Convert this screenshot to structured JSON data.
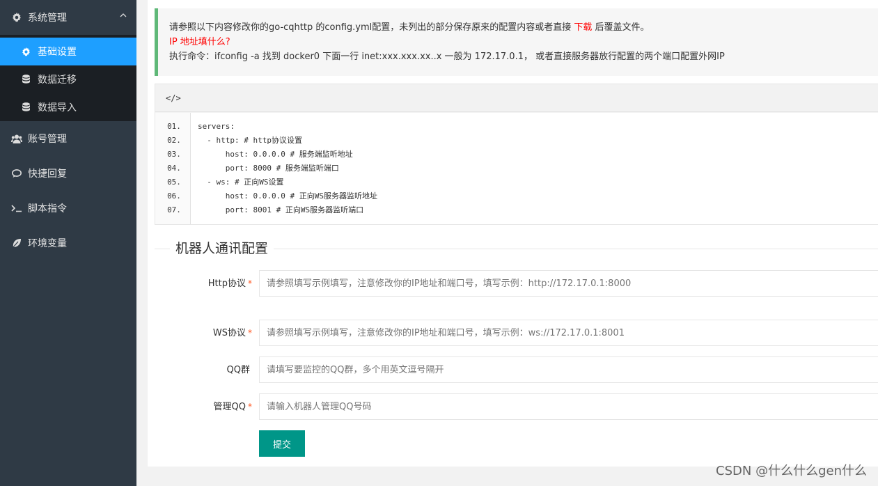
{
  "sidebar": {
    "items": [
      {
        "label": "系统管理",
        "icon": "gear-icon"
      },
      {
        "label": "账号管理",
        "icon": "users-icon"
      },
      {
        "label": "快捷回复",
        "icon": "chat-icon"
      },
      {
        "label": "脚本指令",
        "icon": "terminal-icon"
      },
      {
        "label": "环境变量",
        "icon": "leaf-icon"
      }
    ],
    "submenu": [
      {
        "label": "基础设置",
        "icon": "gear-icon",
        "active": true
      },
      {
        "label": "数据迁移",
        "icon": "database-icon"
      },
      {
        "label": "数据导入",
        "icon": "database-icon"
      }
    ]
  },
  "notice": {
    "line1_prefix": "请参照以下内容修改你的go-cqhttp 的config.yml配置，未列出的部分保存原来的配置内容或者直接 ",
    "line1_link": "下载",
    "line1_suffix": " 后覆盖文件。",
    "line2": "IP 地址填什么?",
    "line3": "执行命令：ifconfig -a 找到 docker0 下面一行 inet:xxx.xxx.xx..x 一般为 172.17.0.1， 或者直接服务器放行配置的两个端口配置外网IP"
  },
  "code": {
    "header": "</>",
    "line_numbers": [
      "01.",
      "02.",
      "03.",
      "04.",
      "05.",
      "06.",
      "07."
    ],
    "lines": [
      "servers:",
      "  - http: # http协议设置",
      "      host: 0.0.0.0 # 服务端监听地址",
      "      port: 8000 # 服务端监听端口",
      "  - ws: # 正向WS设置",
      "      host: 0.0.0.0 # 正向WS服务器监听地址",
      "      port: 8001 # 正向WS服务器监听端口"
    ]
  },
  "form": {
    "legend": "机器人通讯配置",
    "fields": [
      {
        "label": "Http协议",
        "required": "*",
        "placeholder": "请参照填写示例填写，注意修改你的IP地址和端口号，填写示例：http://172.17.0.1:8000"
      },
      {
        "label": "WS协议",
        "required": "*",
        "placeholder": "请参照填写示例填写，注意修改你的IP地址和端口号，填写示例：ws://172.17.0.1:8001"
      },
      {
        "label": "QQ群",
        "required": "",
        "placeholder": "请填写要监控的QQ群，多个用英文逗号隔开"
      },
      {
        "label": "管理QQ",
        "required": "*",
        "placeholder": "请输入机器人管理QQ号码"
      }
    ],
    "submit_label": "提交"
  },
  "watermark": "CSDN @什么什么gen什么",
  "colors": {
    "sidebar_bg": "#2f3a45",
    "submenu_bg": "#1b1f24",
    "active_blue": "#1e9fff",
    "notice_border": "#5fb878",
    "button_green": "#009688",
    "required_star": "#ff5722",
    "link_red": "#ff0000"
  }
}
